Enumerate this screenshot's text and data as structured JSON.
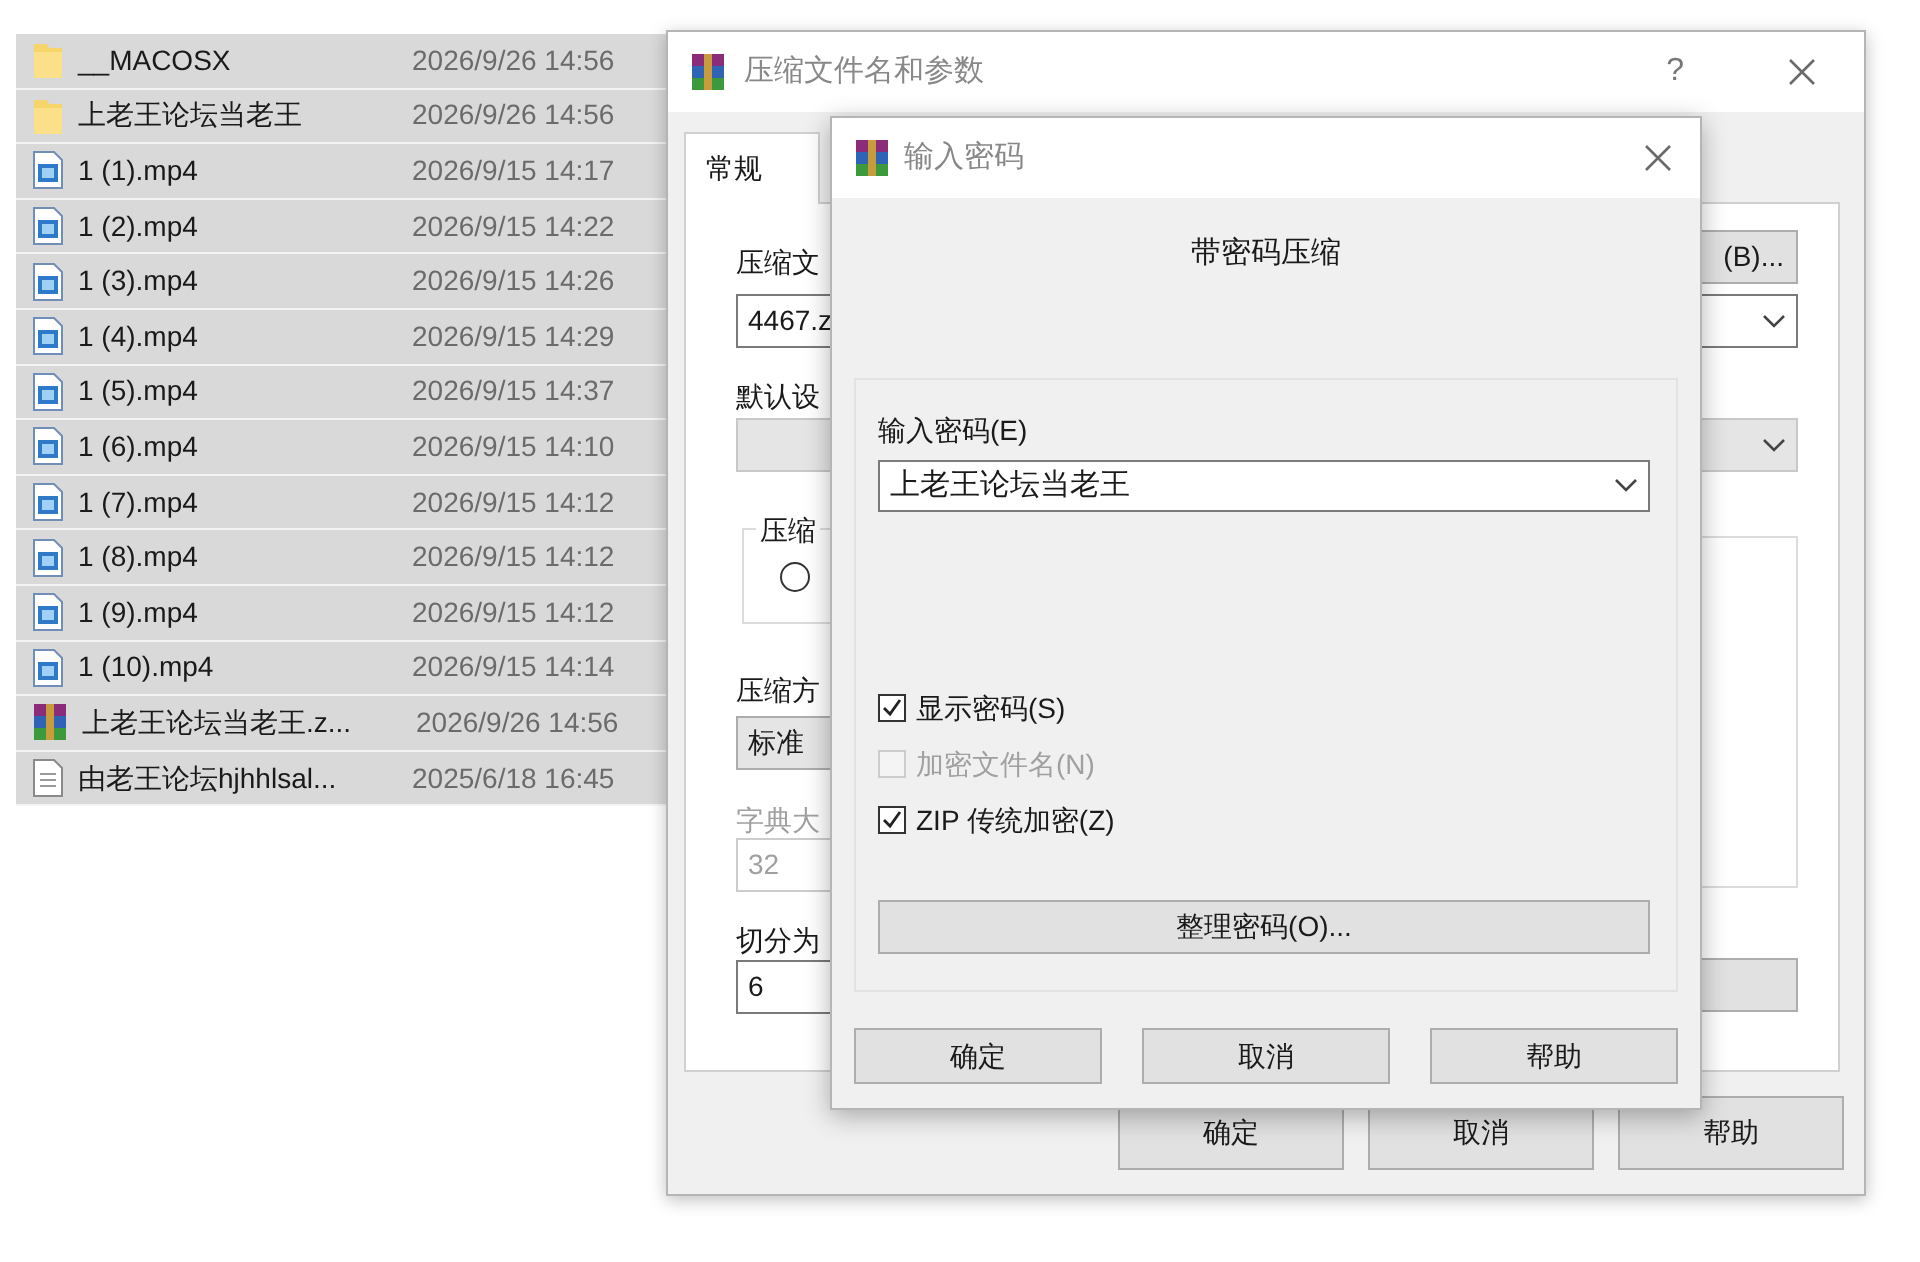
{
  "file_list": {
    "rows": [
      {
        "kind": "folder",
        "name": "__MACOSX",
        "modified": "2026/9/26 14:56",
        "selected": true
      },
      {
        "kind": "folder",
        "name": "上老王论坛当老王",
        "modified": "2026/9/26 14:56",
        "selected": true
      },
      {
        "kind": "video",
        "name": "1 (1).mp4",
        "modified": "2026/9/15 14:17",
        "selected": true
      },
      {
        "kind": "video",
        "name": "1 (2).mp4",
        "modified": "2026/9/15 14:22",
        "selected": true
      },
      {
        "kind": "video",
        "name": "1 (3).mp4",
        "modified": "2026/9/15 14:26",
        "selected": true
      },
      {
        "kind": "video",
        "name": "1 (4).mp4",
        "modified": "2026/9/15 14:29",
        "selected": true
      },
      {
        "kind": "video",
        "name": "1 (5).mp4",
        "modified": "2026/9/15 14:37",
        "selected": true
      },
      {
        "kind": "video",
        "name": "1 (6).mp4",
        "modified": "2026/9/15 14:10",
        "selected": true
      },
      {
        "kind": "video",
        "name": "1 (7).mp4",
        "modified": "2026/9/15 14:12",
        "selected": true
      },
      {
        "kind": "video",
        "name": "1 (8).mp4",
        "modified": "2026/9/15 14:12",
        "selected": true
      },
      {
        "kind": "video",
        "name": "1 (9).mp4",
        "modified": "2026/9/15 14:12",
        "selected": true
      },
      {
        "kind": "video",
        "name": "1 (10).mp4",
        "modified": "2026/9/15 14:14",
        "selected": true
      },
      {
        "kind": "archive",
        "name": "上老王论坛当老王.z...",
        "modified": "2026/9/26 14:56",
        "selected": true
      },
      {
        "kind": "text",
        "name": "由老王论坛hjhhlsal...",
        "modified": "2025/6/18 16:45",
        "selected": true
      }
    ]
  },
  "archive_dialog": {
    "title": "压缩文件名和参数",
    "help": "?",
    "tabs": [
      {
        "label": "常规",
        "selected": true
      }
    ],
    "archive_name_label": "压缩文",
    "browse_button": "(B)...",
    "archive_name": "4467.z",
    "profile_label": "默认设",
    "format_group_label": "压缩",
    "format_radio": {
      "selected": false
    },
    "method_label": "压缩方",
    "method": "标准",
    "dictionary_label": "字典大",
    "dictionary": "32",
    "dictionary_disabled": true,
    "split_label": "切分为",
    "split": "6",
    "buttons": [
      "确定",
      "取消",
      "帮助"
    ]
  },
  "password_dialog": {
    "title": "输入密码",
    "heading": "带密码压缩",
    "password_label": "输入密码(E)",
    "password": "上老王论坛当老王",
    "options": [
      {
        "label": "显示密码(S)",
        "checked": true,
        "disabled": false
      },
      {
        "label": "加密文件名(N)",
        "checked": false,
        "disabled": true
      },
      {
        "label": "ZIP 传统加密(Z)",
        "checked": true,
        "disabled": false
      }
    ],
    "organize_button": "整理密码(O)...",
    "buttons": [
      "确定",
      "取消",
      "帮助"
    ]
  }
}
